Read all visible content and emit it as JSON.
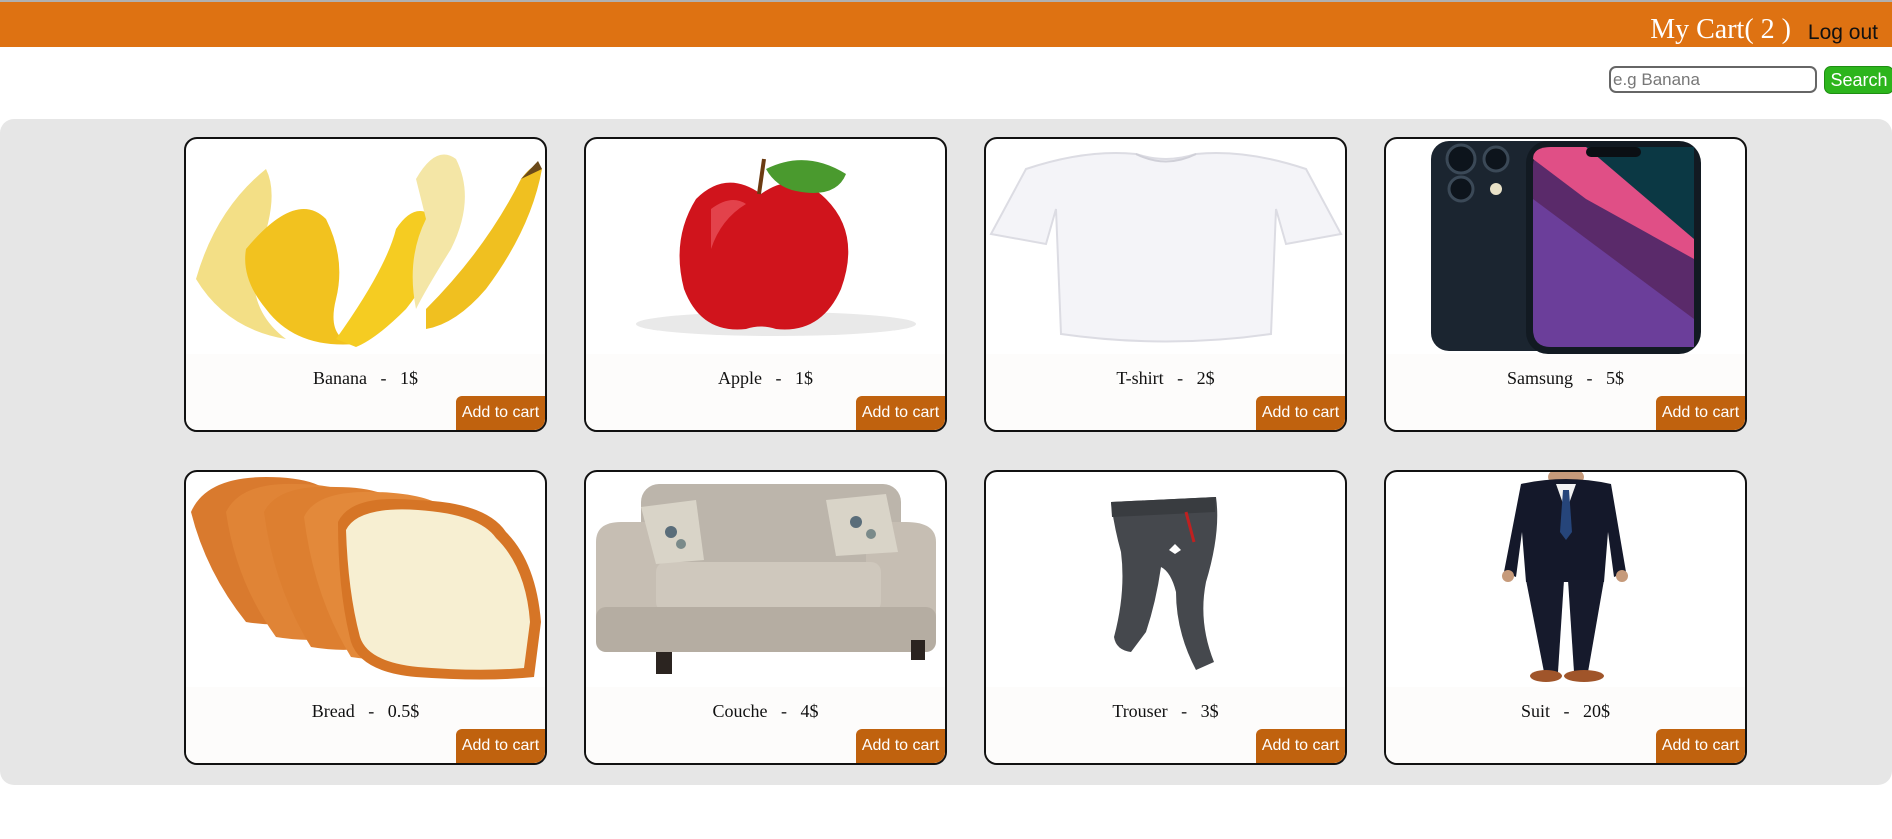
{
  "header": {
    "cart_label": "My Cart( 2 )",
    "logout_label": "Log out"
  },
  "search": {
    "placeholder": "e.g Banana",
    "value": "",
    "button_label": "Search"
  },
  "products": [
    {
      "name": "Banana",
      "price": "1$",
      "title": "Banana   -   1$",
      "button": "Add to cart",
      "icon": "banana-image"
    },
    {
      "name": "Apple",
      "price": "1$",
      "title": "Apple   -   1$",
      "button": "Add to cart",
      "icon": "apple-image"
    },
    {
      "name": "T-shirt",
      "price": "2$",
      "title": "T-shirt   -   2$",
      "button": "Add to cart",
      "icon": "tshirt-image"
    },
    {
      "name": "Samsung",
      "price": "5$",
      "title": "Samsung   -   5$",
      "button": "Add to cart",
      "icon": "phone-image"
    },
    {
      "name": "Bread",
      "price": "0.5$",
      "title": "Bread   -   0.5$",
      "button": "Add to cart",
      "icon": "bread-image"
    },
    {
      "name": "Couche",
      "price": "4$",
      "title": "Couche   -   4$",
      "button": "Add to cart",
      "icon": "couch-image"
    },
    {
      "name": "Trouser",
      "price": "3$",
      "title": "Trouser   -   3$",
      "button": "Add to cart",
      "icon": "trouser-image"
    },
    {
      "name": "Suit",
      "price": "20$",
      "title": "Suit   -   20$",
      "button": "Add to cart",
      "icon": "suit-image"
    }
  ],
  "colors": {
    "header_bg": "#de7212",
    "button_bg": "#c0620e",
    "search_button_bg": "#2cb51c",
    "panel_bg": "#e6e6e6"
  }
}
